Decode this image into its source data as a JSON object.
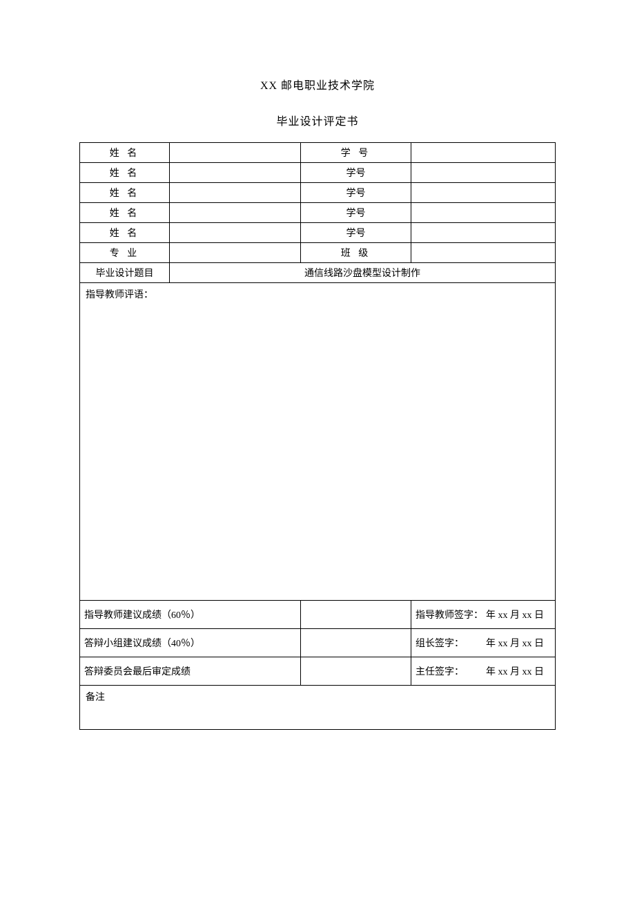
{
  "header": {
    "institution": "XX 邮电职业技术学院",
    "title": "毕业设计评定书"
  },
  "rows": [
    {
      "label": "姓 名",
      "mid": "学  号"
    },
    {
      "label": "姓 名",
      "mid": "学号"
    },
    {
      "label": "姓 名",
      "mid": "学号"
    },
    {
      "label": "姓 名",
      "mid": "学号"
    },
    {
      "label": "姓 名",
      "mid": "学号"
    },
    {
      "label": "专 业",
      "mid": "班  级"
    }
  ],
  "topic": {
    "label": "毕业设计题目",
    "value": "通信线路沙盘模型设计制作"
  },
  "comments": {
    "label": "指导教师评语："
  },
  "scores": [
    {
      "label": "指导教师建议成绩（60％）",
      "sign_label": "指导教师签字：",
      "date": "年 xx 月 xx 日"
    },
    {
      "label": "答辩小组建议成绩（40％）",
      "sign_label": "组长签字：",
      "date": "年 xx 月 xx 日"
    },
    {
      "label": "答辩委员会最后审定成绩",
      "sign_label": "主任签字：",
      "date": "年 xx 月 xx 日"
    }
  ],
  "remark": {
    "label": "备注"
  }
}
